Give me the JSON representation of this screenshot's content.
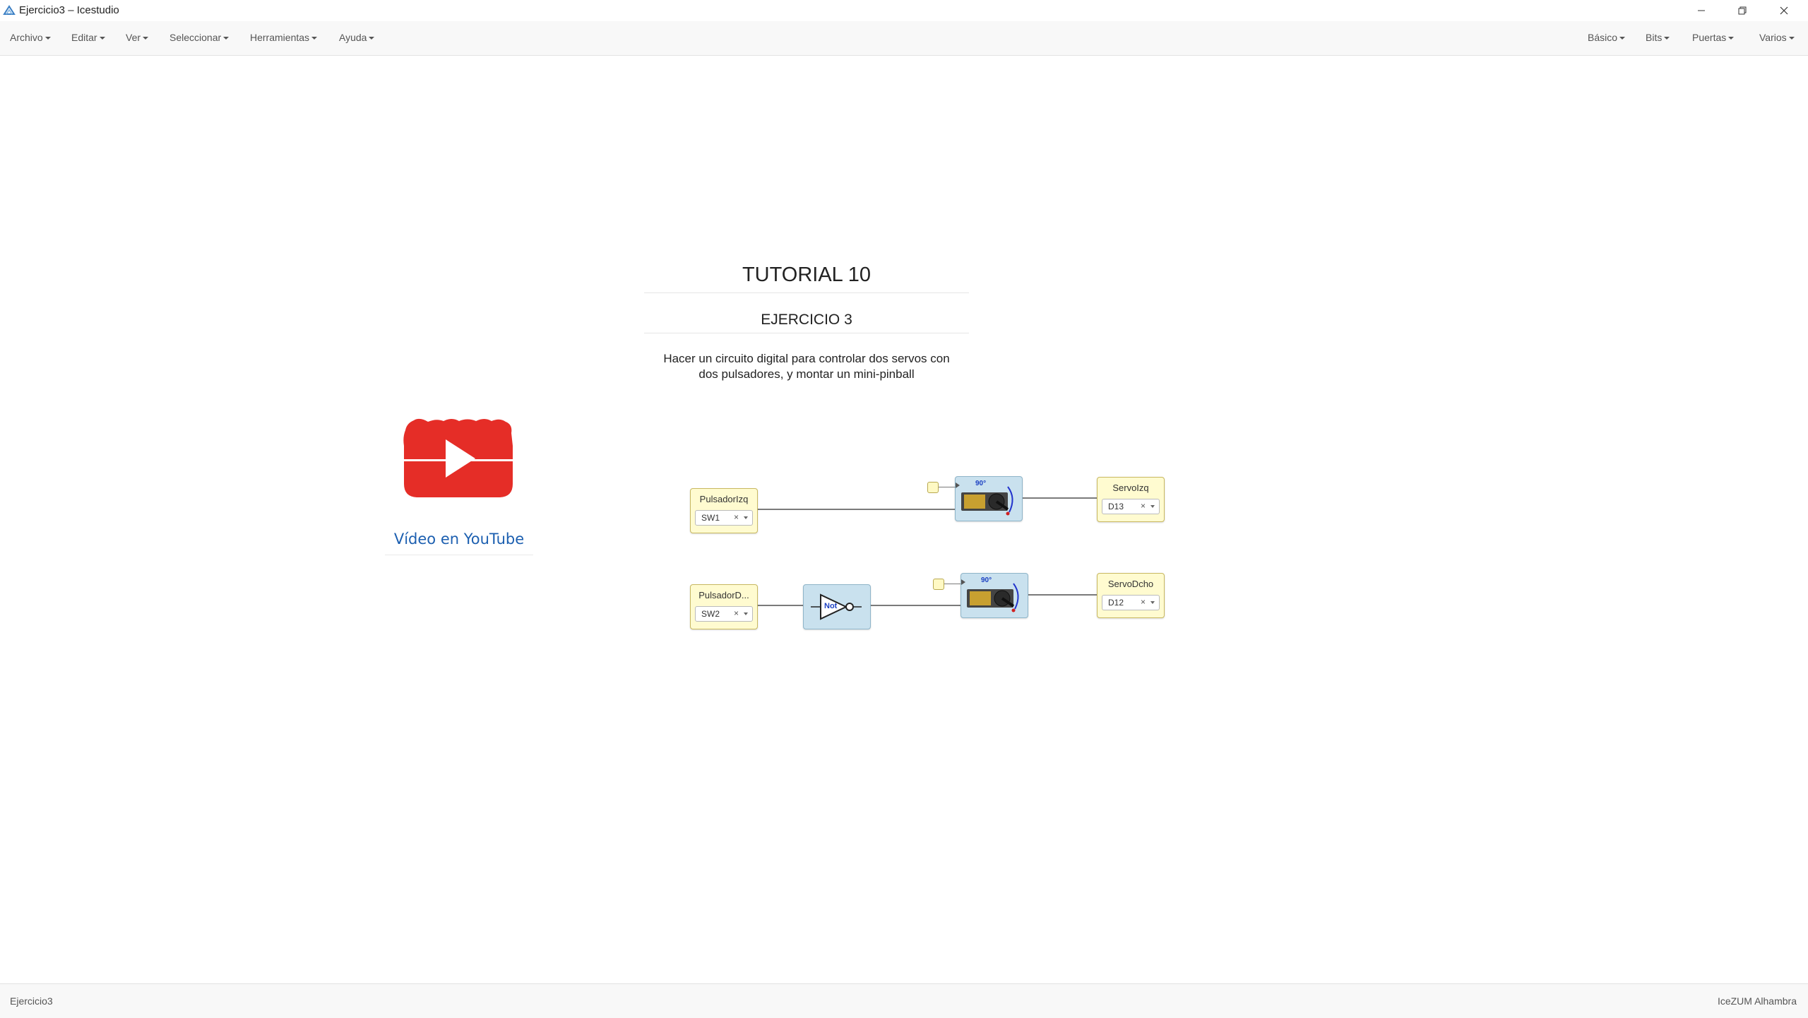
{
  "window": {
    "title": "Ejercicio3 – Icestudio"
  },
  "menubar": {
    "left": [
      "Archivo",
      "Editar",
      "Ver",
      "Seleccionar",
      "Herramientas",
      "Ayuda"
    ],
    "right": [
      "Básico",
      "Bits",
      "Puertas",
      "Varios"
    ]
  },
  "document": {
    "title": "TUTORIAL 10",
    "subtitle": "EJERCICIO 3",
    "description_line1": "Hacer un circuito digital para controlar dos servos con",
    "description_line2": "dos pulsadores, y montar un mini-pinball",
    "video_link": "Vídeo en YouTube"
  },
  "circuit": {
    "inputs": [
      {
        "label": "PulsadorIzq",
        "pin": "SW1"
      },
      {
        "label": "PulsadorD...",
        "pin": "SW2"
      }
    ],
    "outputs": [
      {
        "label": "ServoIzq",
        "pin": "D13"
      },
      {
        "label": "ServoDcho",
        "pin": "D12"
      }
    ],
    "gate": {
      "label": "Not"
    },
    "servo_blocks": [
      {
        "angle": "90°"
      },
      {
        "angle": "90°"
      }
    ],
    "remove_glyph": "×"
  },
  "statusbar": {
    "left": "Ejercicio3",
    "right": "IceZUM Alhambra"
  },
  "colors": {
    "io_block": "#fffbd0",
    "logic_block": "#c9e1ee",
    "link": "#1c5fb0",
    "youtube_red": "#e52d27"
  }
}
